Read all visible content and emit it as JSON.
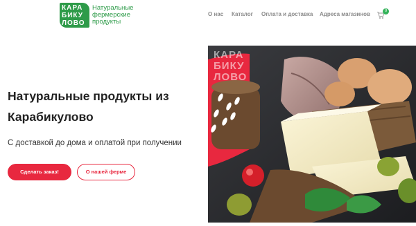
{
  "logo": {
    "mark_lines": [
      "КАРА",
      "БИКУ",
      "ЛОВО"
    ],
    "tagline": "Натуральные фермерские продукты"
  },
  "nav": {
    "items": [
      "О нас",
      "Каталог",
      "Оплата и доставка",
      "Адреса магазинов"
    ]
  },
  "cart": {
    "count": "0",
    "icon": "cart-icon"
  },
  "hero": {
    "title": "Натуральные продукты из Карабикулово",
    "subtitle": "С доставкой до дома и оплатой при получении",
    "primary_button": "Сделать заказ!",
    "secondary_button": "О нашей ферме"
  },
  "photo": {
    "overlay_lines": [
      "КАРА",
      "БИКУ",
      "ЛОВО"
    ]
  },
  "colors": {
    "brand_green": "#2e9b49",
    "accent_red": "#e8283f"
  }
}
